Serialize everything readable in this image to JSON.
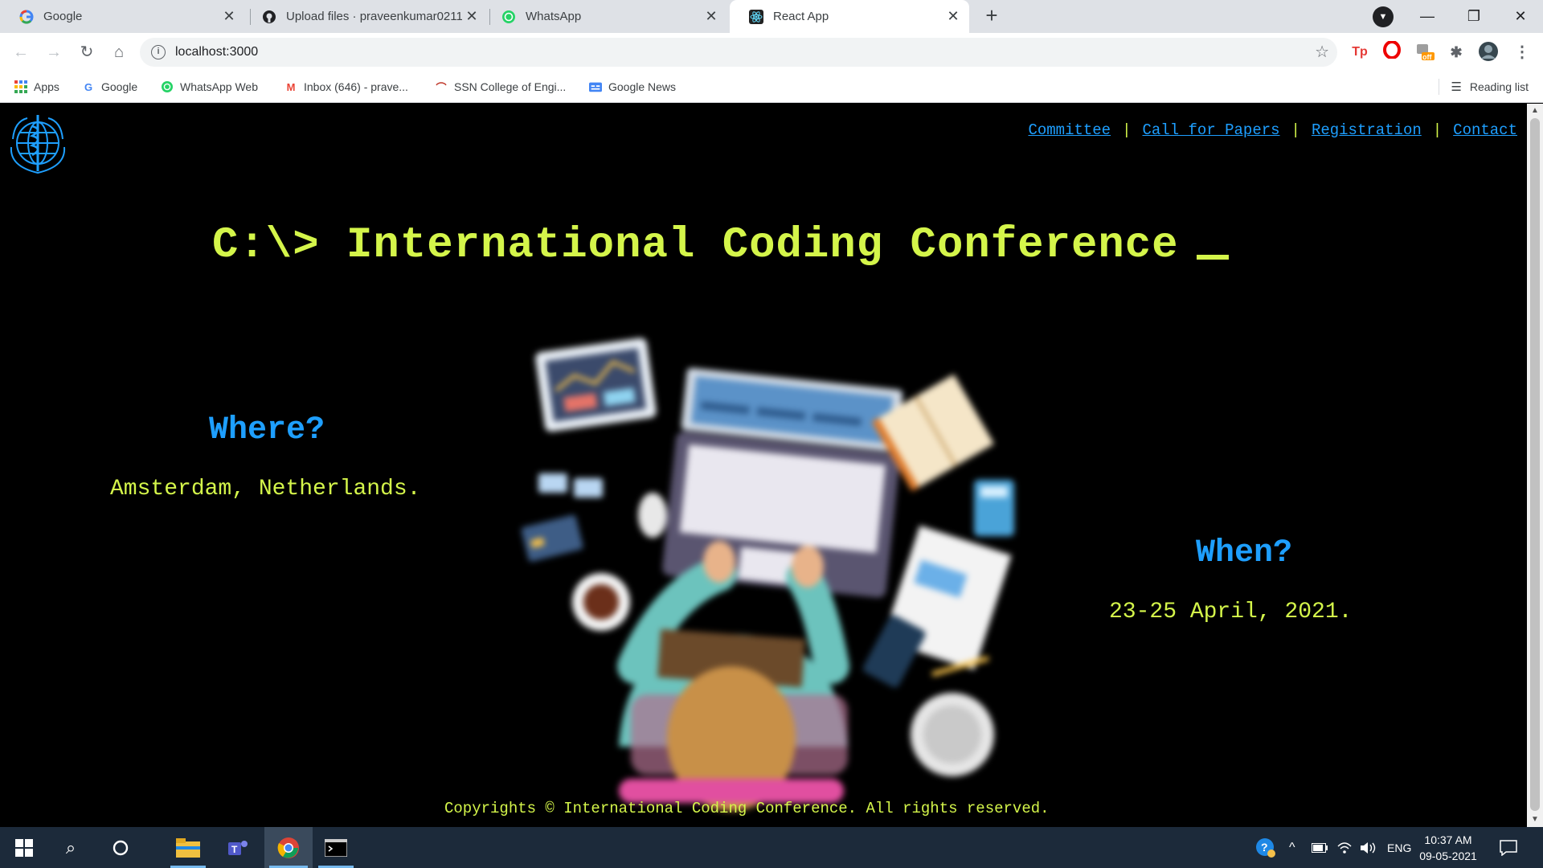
{
  "browser": {
    "tabs": [
      {
        "title": "Google",
        "active": false
      },
      {
        "title": "Upload files · praveenkumar0211",
        "active": false
      },
      {
        "title": "WhatsApp",
        "active": false
      },
      {
        "title": "React App",
        "active": true
      }
    ],
    "new_tab": "+",
    "url": "localhost:3000",
    "bookmarks": [
      {
        "label": "Apps"
      },
      {
        "label": "Google"
      },
      {
        "label": "WhatsApp Web"
      },
      {
        "label": "Inbox (646) - prave..."
      },
      {
        "label": "SSN College of Engi..."
      },
      {
        "label": "Google News"
      }
    ],
    "reading_list": "Reading list",
    "ext_badge": "off"
  },
  "page": {
    "nav": [
      "Committee",
      "Call for Papers",
      "Registration",
      "Contact"
    ],
    "nav_separator": "|",
    "headline": "C:\\> International Coding Conference",
    "where_title": "Where?",
    "where_value": "Amsterdam, Netherlands.",
    "when_title": "When?",
    "when_value": "23-25 April, 2021.",
    "footer": "Copyrights © International Coding Conference. All rights reserved."
  },
  "taskbar": {
    "language": "ENG",
    "time": "10:37 AM",
    "date": "09-05-2021"
  },
  "colors": {
    "accent_yellow": "#d4f54a",
    "accent_blue": "#1e9fff",
    "page_bg": "#000000"
  }
}
